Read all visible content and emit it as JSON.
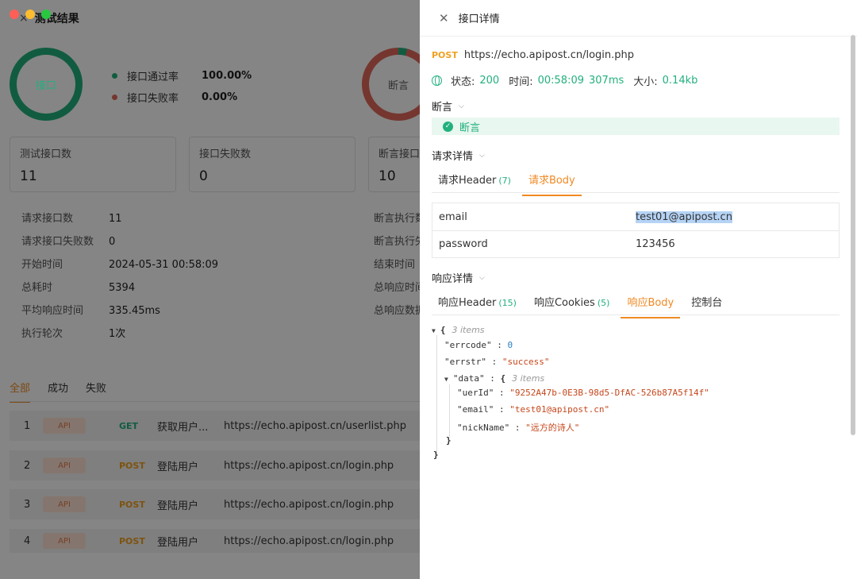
{
  "background": {
    "title": "测试结果",
    "close_glyph": "×",
    "ring_api": "接口",
    "ring_assert": "断言",
    "pass_rate_label": "接口通过率",
    "pass_rate_value": "100.00%",
    "fail_rate_label": "接口失败率",
    "fail_rate_value": "0.00%",
    "cards": [
      {
        "title": "测试接口数",
        "value": "11"
      },
      {
        "title": "接口失败数",
        "value": "0"
      },
      {
        "title": "断言接口",
        "value": "10"
      }
    ],
    "details": [
      {
        "key": "请求接口数",
        "value": "11"
      },
      {
        "key": "请求接口失败数",
        "value": "0"
      },
      {
        "key": "开始时间",
        "value": "2024-05-31 00:58:09"
      },
      {
        "key": "总耗时",
        "value": "5394"
      },
      {
        "key": "平均响应时间",
        "value": "335.45ms"
      },
      {
        "key": "执行轮次",
        "value": "1次"
      }
    ],
    "details_right": [
      "断言执行数",
      "断言执行失",
      "结束时间",
      "总响应时间",
      "总响应数据"
    ],
    "tabs": [
      "全部",
      "成功",
      "失败"
    ],
    "rows": [
      {
        "idx": "1",
        "badge": "API",
        "method": "GET",
        "name": "获取用户...",
        "url": "https://echo.apipost.cn/userlist.php"
      },
      {
        "idx": "2",
        "badge": "API",
        "method": "POST",
        "name": "登陆用户",
        "url": "https://echo.apipost.cn/login.php"
      },
      {
        "idx": "3",
        "badge": "API",
        "method": "POST",
        "name": "登陆用户",
        "url": "https://echo.apipost.cn/login.php"
      },
      {
        "idx": "4",
        "badge": "API",
        "method": "POST",
        "name": "登陆用户",
        "url": "https://echo.apipost.cn/login.php"
      }
    ]
  },
  "drawer": {
    "title": "接口详情",
    "close_glyph": "✕",
    "method": "POST",
    "url": "https://echo.apipost.cn/login.php",
    "status_label": "状态:",
    "status_value": "200",
    "time_label": "时间:",
    "time_value": "00:58:09",
    "duration_value": "307ms",
    "size_label": "大小:",
    "size_value": "0.14kb",
    "assert_section": "断言",
    "assert_item": "断言",
    "request_section": "请求详情",
    "request_tabs": [
      {
        "label": "请求Header",
        "count": "(7)"
      },
      {
        "label": "请求Body",
        "count": ""
      }
    ],
    "body_rows": [
      {
        "key": "email",
        "value": "test01@apipost.cn"
      },
      {
        "key": "password",
        "value": "123456"
      }
    ],
    "response_section": "响应详情",
    "response_tabs": [
      {
        "label": "响应Header",
        "count": "(15)"
      },
      {
        "label": "响应Cookies",
        "count": "(5)"
      },
      {
        "label": "响应Body",
        "count": ""
      },
      {
        "label": "控制台",
        "count": ""
      }
    ],
    "json": {
      "root_count": "3 items",
      "errcode_key": "\"errcode\"",
      "errcode_val": "0",
      "errstr_key": "\"errstr\"",
      "errstr_val": "\"success\"",
      "data_key": "\"data\"",
      "data_count": "3 items",
      "uerid_key": "\"uerId\"",
      "uerid_val": "\"9252A47b-0E3B-98d5-DfAC-526b87A5f14f\"",
      "email_key": "\"email\"",
      "email_val": "\"test01@apipost.cn\"",
      "nick_key": "\"nickName\"",
      "nick_val": "\"远方的诗人\""
    }
  },
  "colors": {
    "accent": "#f08a24",
    "success": "#22b07d",
    "failure": "#e0685a",
    "post": "#f0a020"
  }
}
